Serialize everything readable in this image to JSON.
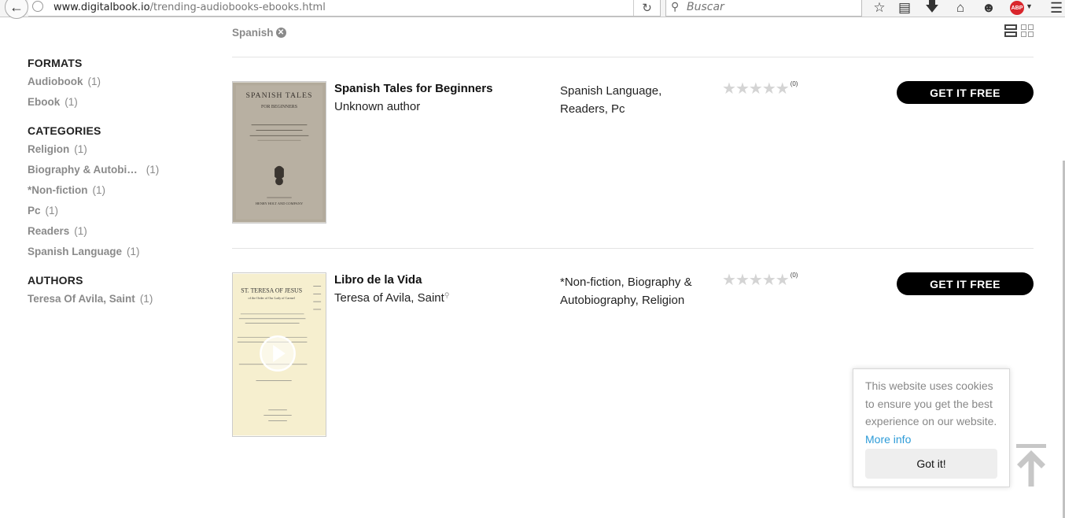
{
  "browser": {
    "url_domain": "www.digitalbook.io",
    "url_path": "/trending-audiobooks-ebooks.html",
    "search_placeholder": "Buscar",
    "abp_label": "ABP"
  },
  "active_filter": {
    "label": "Spanish"
  },
  "sidebar": {
    "formats": {
      "title": "FORMATS",
      "items": [
        {
          "label": "Audiobook",
          "count": "(1)"
        },
        {
          "label": "Ebook",
          "count": "(1)"
        }
      ]
    },
    "categories": {
      "title": "CATEGORIES",
      "items": [
        {
          "label": "Religion",
          "count": "(1)"
        },
        {
          "label": "Biography & Autobi…",
          "count": "(1)"
        },
        {
          "label": "*Non-fiction",
          "count": "(1)"
        },
        {
          "label": "Pc",
          "count": "(1)"
        },
        {
          "label": "Readers",
          "count": "(1)"
        },
        {
          "label": "Spanish Language",
          "count": "(1)"
        }
      ]
    },
    "authors": {
      "title": "AUTHORS",
      "items": [
        {
          "label": "Teresa Of Avila, Saint",
          "count": "(1)"
        }
      ]
    }
  },
  "books": [
    {
      "title": "Spanish Tales for Beginners",
      "author": "Unknown author",
      "subjects": "Spanish Language, Readers, Pc",
      "rating_count": "(0)",
      "rating_value": 0,
      "button_label": "GET IT FREE",
      "cover": {
        "line1": "SPANISH TALES",
        "line2": "FOR BEGINNERS",
        "publisher": "HENRY HOLT AND COMPANY"
      }
    },
    {
      "title": "Libro de la Vida",
      "author": "Teresa of Avila, Saint",
      "subjects": "*Non-fiction, Biography & Autobiography, Religion",
      "rating_count": "(0)",
      "rating_value": 0,
      "button_label": "GET IT FREE",
      "cover": {
        "line1": "ST. TERESA OF JESUS",
        "line2": "of the Order of Our Lady of Carmel"
      }
    }
  ],
  "cookie": {
    "message": "This website uses cookies to ensure you get the best experience on our website.",
    "link": "More info",
    "button": "Got it!"
  }
}
